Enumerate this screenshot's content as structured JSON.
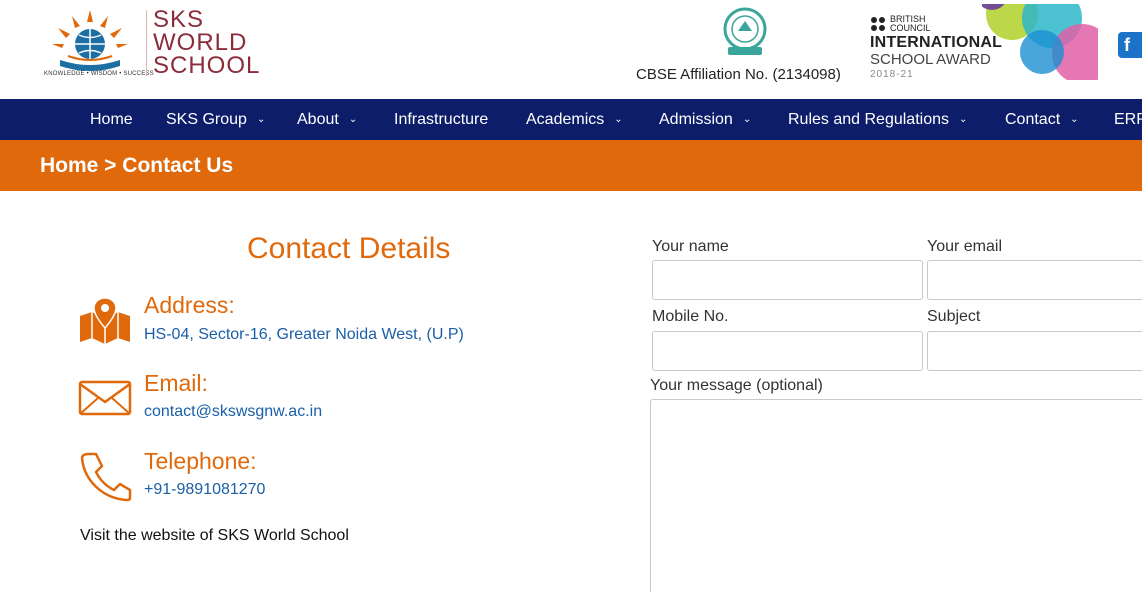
{
  "header": {
    "logo": {
      "line1": "SKS",
      "line2": "WORLD",
      "line3": "SCHOOL",
      "tagline": "KNOWLEDGE • WISDOM • SUCCESS"
    },
    "cbse_affiliation": "CBSE Affiliation No. (2134098)",
    "british_council": {
      "org_line1": "BRITISH",
      "org_line2": "COUNCIL",
      "award_line1": "INTERNATIONAL",
      "award_line2": "SCHOOL AWARD",
      "years": "2018-21"
    },
    "social_icon": "facebook-icon"
  },
  "nav": {
    "items": [
      {
        "label": "Home",
        "dropdown": false
      },
      {
        "label": "SKS Group",
        "dropdown": true
      },
      {
        "label": "About",
        "dropdown": true
      },
      {
        "label": "Infrastructure",
        "dropdown": false
      },
      {
        "label": "Academics",
        "dropdown": true
      },
      {
        "label": "Admission",
        "dropdown": true
      },
      {
        "label": "Rules and Regulations",
        "dropdown": true
      },
      {
        "label": "Contact",
        "dropdown": true
      },
      {
        "label": "ERP",
        "dropdown": false
      }
    ]
  },
  "breadcrumb": "Home > Contact Us",
  "contact": {
    "title": "Contact Details",
    "address_label": "Address:",
    "address_value": "HS-04, Sector-16, Greater Noida West, (U.P)",
    "email_label": "Email:",
    "email_value": "contact@skswsgnw.ac.in",
    "phone_label": "Telephone:",
    "phone_value": "+91-9891081270",
    "visit_text": "Visit the website of SKS World School"
  },
  "form": {
    "name_label": "Your name",
    "email_label": "Your email",
    "mobile_label": "Mobile No.",
    "subject_label": "Subject",
    "message_label": "Your message (optional)"
  },
  "colors": {
    "nav_bg": "#0d1d6a",
    "accent_orange": "#e0690c",
    "link_blue": "#1a5fa8",
    "logo_maroon": "#8a2c3a"
  }
}
